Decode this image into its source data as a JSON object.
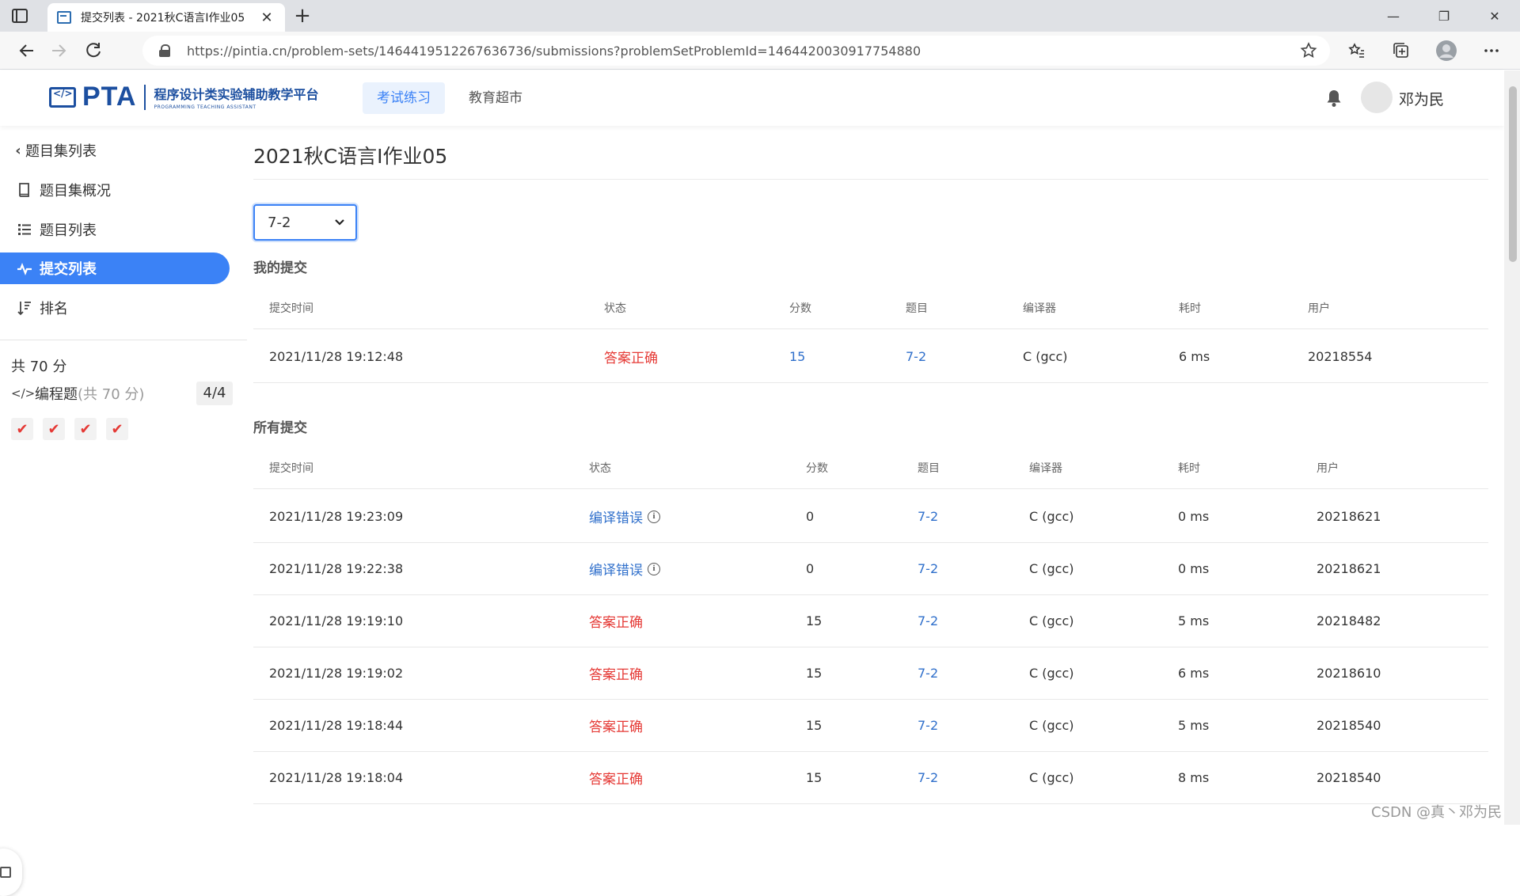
{
  "browser": {
    "tab_title": "提交列表 - 2021秋C语言I作业05",
    "tab_close": "✕",
    "new_tab": "+",
    "url": "https://pintia.cn/problem-sets/1464419512267636736/submissions?problemSetProblemId=1464420030917754880",
    "window_buttons": [
      "—",
      "❐",
      "✕"
    ]
  },
  "header": {
    "logo_text": "PTA",
    "logo_cn": "程序设计类实验辅助教学平台",
    "logo_en": "PROGRAMMING TEACHING ASSISTANT",
    "nav": [
      "考试练习",
      "教育超市"
    ],
    "user_name": "邓为民",
    "accent_color": "#3b82f6"
  },
  "sidebar": {
    "back_label": "题目集列表",
    "items": [
      {
        "label": "题目集概况",
        "icon": "book-icon"
      },
      {
        "label": "题目列表",
        "icon": "list-icon"
      },
      {
        "label": "提交列表",
        "icon": "pulse-icon",
        "active": true
      },
      {
        "label": "排名",
        "icon": "sort-icon"
      }
    ],
    "total": "共 70 分",
    "programming_label": "编程题",
    "programming_sub": "(共 70 分)",
    "programming_count": "4/4",
    "checks": [
      "✔",
      "✔",
      "✔",
      "✔"
    ]
  },
  "main": {
    "title": "2021秋C语言I作业05",
    "problem_select": "7-2",
    "my_section": "我的提交",
    "all_section": "所有提交",
    "columns": [
      "提交时间",
      "状态",
      "分数",
      "题目",
      "编译器",
      "耗时",
      "用户"
    ],
    "my_rows": [
      {
        "time": "2021/11/28 19:12:48",
        "status": "答案正确",
        "status_type": "ok",
        "score": "15",
        "problem": "7-2",
        "compiler": "C (gcc)",
        "duration": "6 ms",
        "user": "20218554"
      }
    ],
    "all_rows": [
      {
        "time": "2021/11/28 19:23:09",
        "status": "编译错误",
        "status_type": "ce",
        "score": "0",
        "problem": "7-2",
        "compiler": "C (gcc)",
        "duration": "0 ms",
        "user": "20218621"
      },
      {
        "time": "2021/11/28 19:22:38",
        "status": "编译错误",
        "status_type": "ce",
        "score": "0",
        "problem": "7-2",
        "compiler": "C (gcc)",
        "duration": "0 ms",
        "user": "20218621"
      },
      {
        "time": "2021/11/28 19:19:10",
        "status": "答案正确",
        "status_type": "ok",
        "score": "15",
        "problem": "7-2",
        "compiler": "C (gcc)",
        "duration": "5 ms",
        "user": "20218482"
      },
      {
        "time": "2021/11/28 19:19:02",
        "status": "答案正确",
        "status_type": "ok",
        "score": "15",
        "problem": "7-2",
        "compiler": "C (gcc)",
        "duration": "6 ms",
        "user": "20218610"
      },
      {
        "time": "2021/11/28 19:18:44",
        "status": "答案正确",
        "status_type": "ok",
        "score": "15",
        "problem": "7-2",
        "compiler": "C (gcc)",
        "duration": "5 ms",
        "user": "20218540"
      },
      {
        "time": "2021/11/28 19:18:04",
        "status": "答案正确",
        "status_type": "ok",
        "score": "15",
        "problem": "7-2",
        "compiler": "C (gcc)",
        "duration": "8 ms",
        "user": "20218540"
      }
    ],
    "info_glyph": "i"
  },
  "watermark": "CSDN @真丶邓为民"
}
